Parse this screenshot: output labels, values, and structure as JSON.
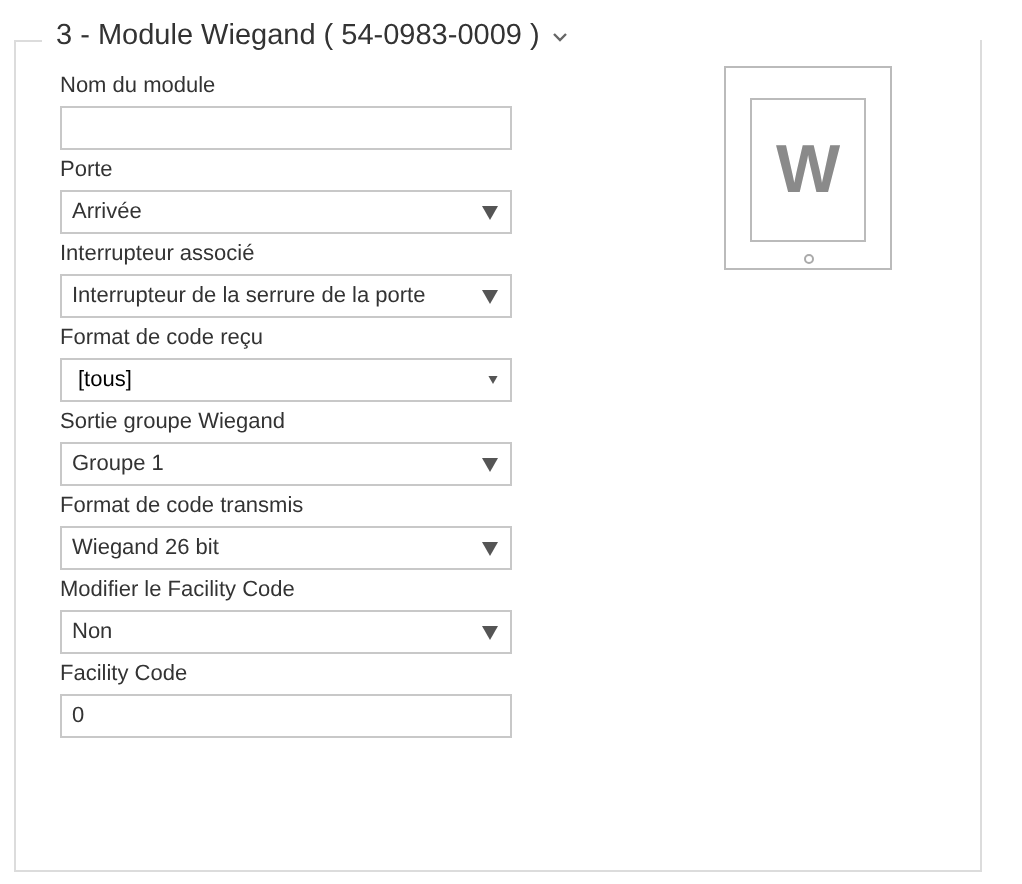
{
  "section": {
    "title": "3 - Module Wiegand ( 54-0983-0009 )",
    "expanded": true
  },
  "fields": [
    {
      "label": "Nom du module",
      "kind": "text"
    },
    {
      "label": "Porte",
      "kind": "select",
      "value": "Arrivée"
    },
    {
      "label": "Interrupteur associé",
      "kind": "select",
      "value": "Interrupteur de la serrure de la porte"
    },
    {
      "label": "Format de code reçu",
      "kind": "native-select",
      "value": "[tous]"
    },
    {
      "label": "Sortie groupe Wiegand",
      "kind": "select",
      "value": "Groupe 1"
    },
    {
      "label": "Format de code transmis",
      "kind": "select",
      "value": "Wiegand 26 bit"
    },
    {
      "label": "Modifier le Facility Code",
      "kind": "select",
      "value": "Non"
    },
    {
      "label": "Facility Code",
      "kind": "text",
      "value": "0"
    }
  ],
  "module_image": {
    "letter": "W"
  }
}
